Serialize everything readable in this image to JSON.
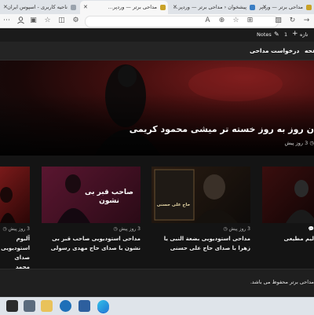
{
  "browser": {
    "tabs": [
      {
        "label": "ناحیه کاربری - اسپوس ایران",
        "active": false
      },
      {
        "label": "مداحی برتر — وردپر...",
        "active": true
      },
      {
        "label": "پیشخوان ‹ مداحی برتر — وردپر...",
        "active": false
      },
      {
        "label": "مداحی برتر — وردپر...",
        "active": false
      }
    ],
    "new_tab": "+",
    "tab_close": "✕"
  },
  "site_bar": {
    "notes_label": "Notes",
    "add_label": "تازه",
    "count": "1"
  },
  "nav": {
    "items": [
      "درخواست مداحی",
      "صفحه"
    ]
  },
  "hero": {
    "title": "ن روز به روز خسته تر میشی محمود کریمی",
    "meta": "3 روز پیش"
  },
  "cards": [
    {
      "meta": "",
      "title": "لیم مطیعی",
      "thumb_text": ""
    },
    {
      "meta": "3 روز پیش",
      "title": "مداحی استودیویی بضعة النبی یا زهرا با صدای حاج علی حسنی",
      "thumb_text": "حاج علی حسنی"
    },
    {
      "meta": "3 روز پیش",
      "title": "مداحی استودیویی صاحب قبر بی نشون با صدای حاج مهدی رسولی",
      "thumb_text": "صاحب قبر بی نشون"
    },
    {
      "meta": "3 روز پیش",
      "title": "آلبوم استودیویی صدای محمد",
      "thumb_text": ""
    }
  ],
  "footer": {
    "copyright": "مداحی برتر محفوظ می باشد."
  },
  "colors": {
    "accent_red": "#8a1e1e",
    "page_bg": "#141414"
  }
}
